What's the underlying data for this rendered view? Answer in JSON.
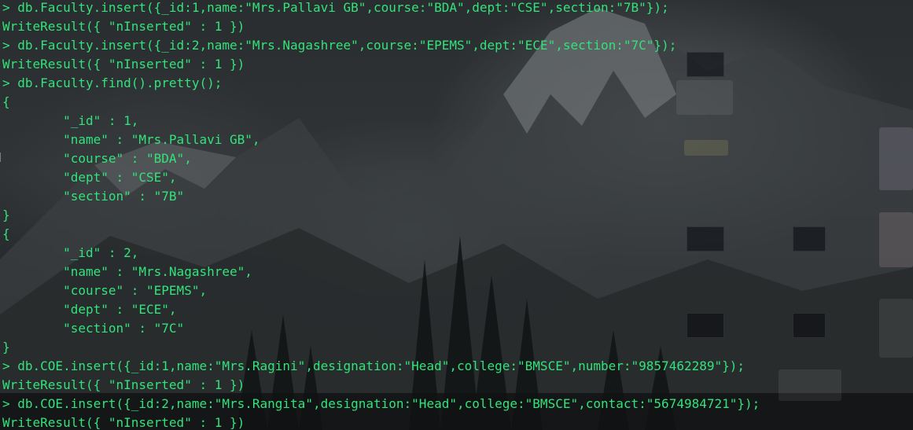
{
  "terminal": {
    "lines": [
      "> db.Faculty.insert({_id:1,name:\"Mrs.Pallavi GB\",course:\"BDA\",dept:\"CSE\",section:\"7B\"});",
      "WriteResult({ \"nInserted\" : 1 })",
      "> db.Faculty.insert({_id:2,name:\"Mrs.Nagashree\",course:\"EPEMS\",dept:\"ECE\",section:\"7C\"});",
      "WriteResult({ \"nInserted\" : 1 })",
      "> db.Faculty.find().pretty();",
      "{",
      "        \"_id\" : 1,",
      "        \"name\" : \"Mrs.Pallavi GB\",",
      "        \"course\" : \"BDA\",",
      "        \"dept\" : \"CSE\",",
      "        \"section\" : \"7B\"",
      "}",
      "{",
      "        \"_id\" : 2,",
      "        \"name\" : \"Mrs.Nagashree\",",
      "        \"course\" : \"EPEMS\",",
      "        \"dept\" : \"ECE\",",
      "        \"section\" : \"7C\"",
      "}",
      "> db.COE.insert({_id:1,name:\"Mrs.Ragini\",designation:\"Head\",college:\"BMSCE\",number:\"9857462289\"});",
      "WriteResult({ \"nInserted\" : 1 })",
      "> db.COE.insert({_id:2,name:\"Mrs.Rangita\",designation:\"Head\",college:\"BMSCE\",contact:\"5674984721\"});",
      "WriteResult({ \"nInserted\" : 1 })"
    ]
  },
  "colors": {
    "text": "#32e27a",
    "background": "#1c1f20"
  }
}
